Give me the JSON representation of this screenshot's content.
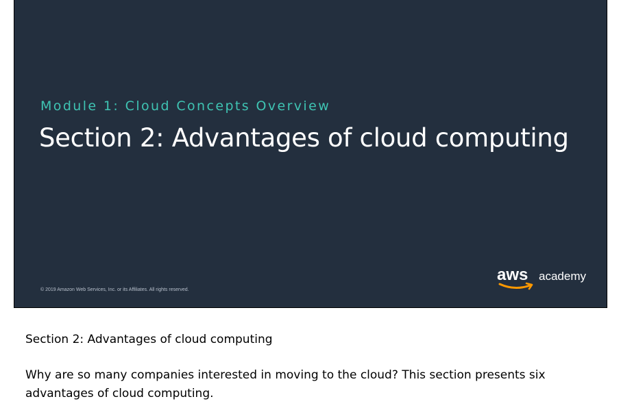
{
  "slide": {
    "module_label": "Module 1: Cloud Concepts Overview",
    "section_title": "Section 2: Advantages of cloud computing",
    "copyright": "© 2019 Amazon Web Services, Inc. or its Affiliates. All rights reserved.",
    "logo": {
      "brand": "aws",
      "product": "academy",
      "smile_color": "#ff9900"
    },
    "background_color": "#232f3e",
    "accent_color": "#3fc4b3"
  },
  "notes": {
    "title": "Section 2: Advantages of cloud computing",
    "body": "Why are so many companies interested in moving to the cloud? This section presents six advantages of cloud computing."
  }
}
